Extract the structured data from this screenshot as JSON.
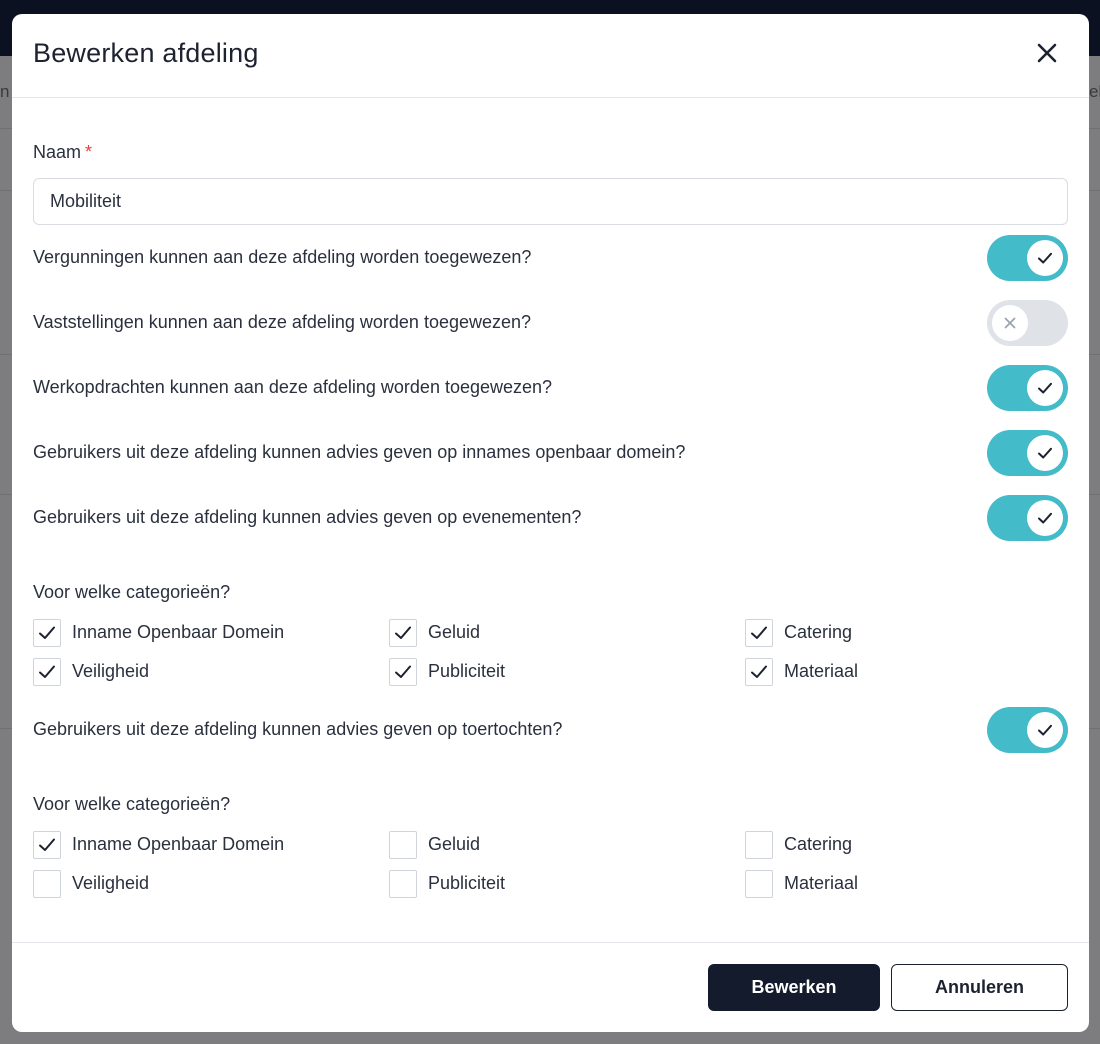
{
  "background": {
    "left_edge_text": "n",
    "right_edge_text": "el"
  },
  "modal": {
    "title": "Bewerken afdeling",
    "close_icon": "close-icon"
  },
  "form": {
    "name_label": "Naam",
    "required_marker": "*",
    "name_value": "Mobiliteit",
    "toggles": [
      {
        "label": "Vergunningen kunnen aan deze afdeling worden toegewezen?",
        "on": true
      },
      {
        "label": "Vaststellingen kunnen aan deze afdeling worden toegewezen?",
        "on": false
      },
      {
        "label": "Werkopdrachten kunnen aan deze afdeling worden toegewezen?",
        "on": true
      },
      {
        "label": "Gebruikers uit deze afdeling kunnen advies geven op innames openbaar domein?",
        "on": true
      },
      {
        "label": "Gebruikers uit deze afdeling kunnen advies geven op evenementen?",
        "on": true
      }
    ],
    "events_categories": {
      "heading": "Voor welke categorieën?",
      "items": [
        {
          "label": "Inname Openbaar Domein",
          "checked": true
        },
        {
          "label": "Geluid",
          "checked": true
        },
        {
          "label": "Catering",
          "checked": true
        },
        {
          "label": "Veiligheid",
          "checked": true
        },
        {
          "label": "Publiciteit",
          "checked": true
        },
        {
          "label": "Materiaal",
          "checked": true
        }
      ]
    },
    "tours_toggle": {
      "label": "Gebruikers uit deze afdeling kunnen advies geven op toertochten?",
      "on": true
    },
    "tours_categories": {
      "heading": "Voor welke categorieën?",
      "items": [
        {
          "label": "Inname Openbaar Domein",
          "checked": true
        },
        {
          "label": "Geluid",
          "checked": false
        },
        {
          "label": "Catering",
          "checked": false
        },
        {
          "label": "Veiligheid",
          "checked": false
        },
        {
          "label": "Publiciteit",
          "checked": false
        },
        {
          "label": "Materiaal",
          "checked": false
        }
      ]
    }
  },
  "footer": {
    "submit_label": "Bewerken",
    "cancel_label": "Annuleren"
  },
  "colors": {
    "toggle_on": "#44bbc9",
    "toggle_off": "#dfe3e7",
    "primary_button": "#141b2d",
    "required_star": "#e53e3e"
  }
}
